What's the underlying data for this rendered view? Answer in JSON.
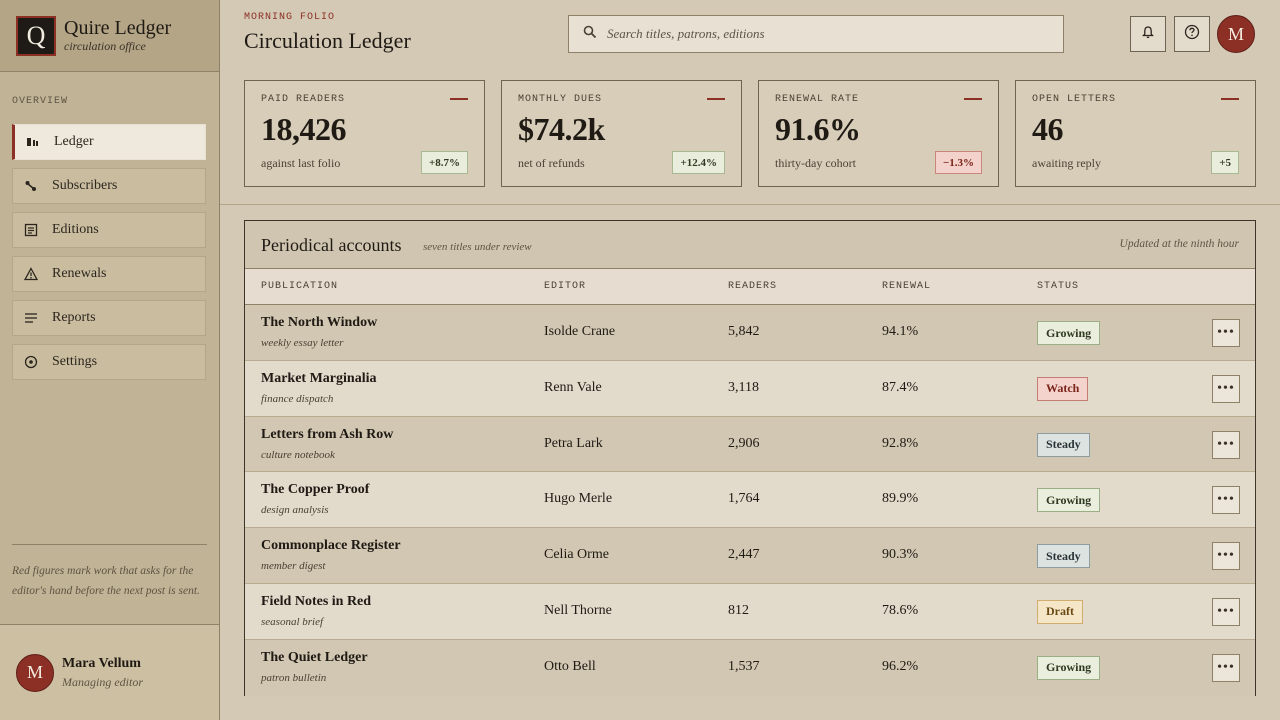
{
  "brand": {
    "logo_letter": "Q",
    "name": "Quire Ledger",
    "subtitle": "circulation office"
  },
  "sidebar": {
    "section_title": "OVERVIEW",
    "items": [
      {
        "label": "Ledger",
        "icon": "ledger-icon",
        "active": true
      },
      {
        "label": "Subscribers",
        "icon": "subscribers-icon",
        "active": false
      },
      {
        "label": "Editions",
        "icon": "editions-icon",
        "active": false
      },
      {
        "label": "Renewals",
        "icon": "renewals-icon",
        "active": false
      },
      {
        "label": "Reports",
        "icon": "reports-icon",
        "active": false
      },
      {
        "label": "Settings",
        "icon": "settings-icon",
        "active": false
      }
    ],
    "note": "Red figures mark work that asks for the editor's hand before the next post is sent."
  },
  "profile": {
    "initial": "M",
    "name": "Mara Vellum",
    "role": "Managing editor"
  },
  "header": {
    "eyebrow": "MORNING FOLIO",
    "title": "Circulation Ledger",
    "search_placeholder": "Search titles, patrons, editions",
    "avatar_initial": "M"
  },
  "stats": [
    {
      "label": "PAID READERS",
      "value": "18,426",
      "sub": "against last folio",
      "delta": "+8.7%",
      "trend": "up"
    },
    {
      "label": "MONTHLY DUES",
      "value": "$74.2k",
      "sub": "net of refunds",
      "delta": "+12.4%",
      "trend": "up"
    },
    {
      "label": "RENEWAL RATE",
      "value": "91.6%",
      "sub": "thirty-day cohort",
      "delta": "−1.3%",
      "trend": "down"
    },
    {
      "label": "OPEN LETTERS",
      "value": "46",
      "sub": "awaiting reply",
      "delta": "+5",
      "trend": "up"
    }
  ],
  "panel": {
    "title": "Periodical accounts",
    "subtitle": "seven titles under review",
    "updated": "Updated at the ninth hour",
    "columns": [
      "PUBLICATION",
      "EDITOR",
      "READERS",
      "RENEWAL",
      "STATUS"
    ],
    "rows": [
      {
        "name": "The North Window",
        "desc": "weekly essay letter",
        "editor": "Isolde Crane",
        "readers": "5,842",
        "renewal": "94.1%",
        "status": "Growing"
      },
      {
        "name": "Market Marginalia",
        "desc": "finance dispatch",
        "editor": "Renn Vale",
        "readers": "3,118",
        "renewal": "87.4%",
        "status": "Watch"
      },
      {
        "name": "Letters from Ash Row",
        "desc": "culture notebook",
        "editor": "Petra Lark",
        "readers": "2,906",
        "renewal": "92.8%",
        "status": "Steady"
      },
      {
        "name": "The Copper Proof",
        "desc": "design analysis",
        "editor": "Hugo Merle",
        "readers": "1,764",
        "renewal": "89.9%",
        "status": "Growing"
      },
      {
        "name": "Commonplace Register",
        "desc": "member digest",
        "editor": "Celia Orme",
        "readers": "2,447",
        "renewal": "90.3%",
        "status": "Steady"
      },
      {
        "name": "Field Notes in Red",
        "desc": "seasonal brief",
        "editor": "Nell Thorne",
        "readers": "812",
        "renewal": "78.6%",
        "status": "Draft"
      },
      {
        "name": "The Quiet Ledger",
        "desc": "patron bulletin",
        "editor": "Otto Bell",
        "readers": "1,537",
        "renewal": "96.2%",
        "status": "Growing"
      }
    ]
  },
  "colors": {
    "accent": "#8c2f25",
    "ink": "#1f1a14",
    "paper": "#d4c9b5"
  }
}
